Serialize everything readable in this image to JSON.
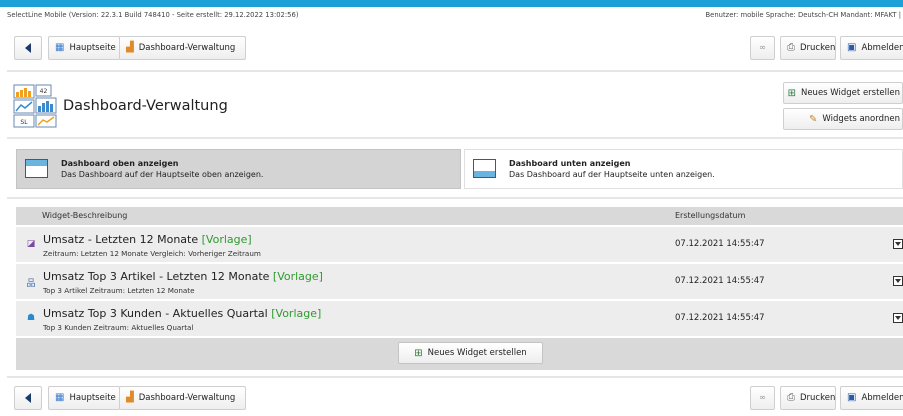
{
  "header": {
    "version_info": "SelectLine Mobile (Version: 22.3.1 Build 748410 - Seite erstellt: 29.12.2022 13:02:56)",
    "user_info": "Benutzer: mobile  Sprache: Deutsch-CH  Mandant: MFAKT |"
  },
  "toolbar": {
    "home_label": "Hauptseite",
    "dashboard_label": "Dashboard-Verwaltung",
    "print_label": "Drucken",
    "logout_label": "Abmelden"
  },
  "page": {
    "title": "Dashboard-Verwaltung",
    "logo_number": "42",
    "logo_text": "SL"
  },
  "actions": {
    "new_widget_label": "Neues Widget erstellen",
    "arrange_widgets_label": "Widgets anordnen"
  },
  "options": [
    {
      "title": "Dashboard oben anzeigen",
      "description": "Das Dashboard auf der Hauptseite oben anzeigen.",
      "selected": true
    },
    {
      "title": "Dashboard unten anzeigen",
      "description": "Das Dashboard auf der Hauptseite unten anzeigen.",
      "selected": false
    }
  ],
  "table": {
    "columns": {
      "description": "Widget-Beschreibung",
      "date": "Erstellungsdatum"
    },
    "rows": [
      {
        "title": "Umsatz - Letzten 12 Monate",
        "tag": "[Vorlage]",
        "subtitle": "Zeitraum: Letzten 12 Monate  Vergleich: Vorheriger Zeitraum",
        "date": "07.12.2021 14:55:47",
        "icon": "chart-icon"
      },
      {
        "title": "Umsatz Top 3 Artikel - Letzten 12 Monate",
        "tag": "[Vorlage]",
        "subtitle": "Top 3 Artikel  Zeitraum: Letzten 12 Monate",
        "date": "07.12.2021 14:55:47",
        "icon": "hierarchy-icon"
      },
      {
        "title": "Umsatz Top 3 Kunden - Aktuelles Quartal",
        "tag": "[Vorlage]",
        "subtitle": "Top 3 Kunden  Zeitraum: Aktuelles Quartal",
        "date": "07.12.2021 14:55:47",
        "icon": "person-icon"
      }
    ]
  },
  "footer": {
    "new_widget_label": "Neues Widget erstellen"
  },
  "colors": {
    "accent_bar": "#1ba0d8",
    "vorlage_tag": "#2f9a2f",
    "selected_option_bg": "#d4d4d4"
  }
}
